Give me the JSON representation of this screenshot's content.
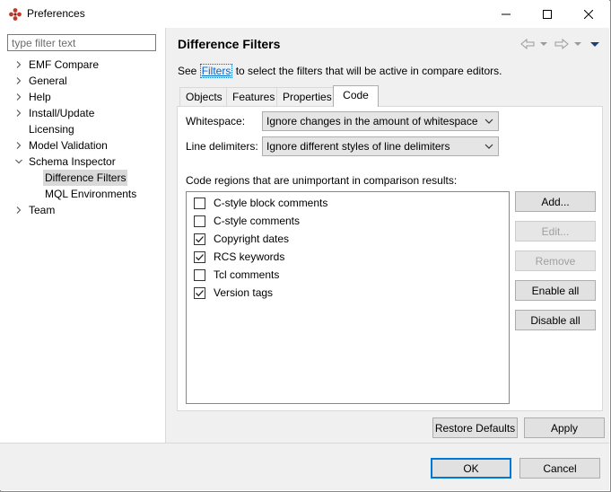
{
  "window": {
    "title": "Preferences"
  },
  "left": {
    "filter_placeholder": "type filter text",
    "tree": [
      {
        "label": "EMF Compare",
        "arrow": "right"
      },
      {
        "label": "General",
        "arrow": "right"
      },
      {
        "label": "Help",
        "arrow": "right"
      },
      {
        "label": "Install/Update",
        "arrow": "right"
      },
      {
        "label": "Licensing",
        "arrow": "none"
      },
      {
        "label": "Model Validation",
        "arrow": "right"
      },
      {
        "label": "Schema Inspector",
        "arrow": "down"
      },
      {
        "label": "Difference Filters",
        "arrow": "none",
        "selected": true
      },
      {
        "label": "MQL Environments",
        "arrow": "none"
      },
      {
        "label": "Team",
        "arrow": "right"
      }
    ]
  },
  "page": {
    "title": "Difference Filters",
    "desc_before": "See ",
    "desc_link": "Filters",
    "desc_after": " to select the filters that will be active in compare editors."
  },
  "tabs": [
    "Objects",
    "Features",
    "Properties",
    "Code"
  ],
  "code": {
    "whitespace_label": "Whitespace:",
    "whitespace_value": "Ignore changes in the amount of whitespace",
    "line_delim_label": "Line delimiters:",
    "line_delim_value": "Ignore different styles of line delimiters",
    "regions_label": "Code regions that are unimportant in comparison results:",
    "regions": [
      {
        "label": "C-style block comments",
        "checked": false
      },
      {
        "label": "C-style comments",
        "checked": false
      },
      {
        "label": "Copyright dates",
        "checked": true
      },
      {
        "label": "RCS keywords",
        "checked": true
      },
      {
        "label": "Tcl comments",
        "checked": false
      },
      {
        "label": "Version tags",
        "checked": true
      }
    ],
    "buttons": {
      "add": "Add...",
      "edit": "Edit...",
      "remove": "Remove",
      "enable_all": "Enable all",
      "disable_all": "Disable all"
    }
  },
  "actions": {
    "restore_defaults": "Restore Defaults",
    "apply": "Apply",
    "ok": "OK",
    "cancel": "Cancel"
  },
  "colors": {
    "accent": "#0078d7",
    "link": "#0066cc",
    "selection": "#d9d9d9"
  }
}
